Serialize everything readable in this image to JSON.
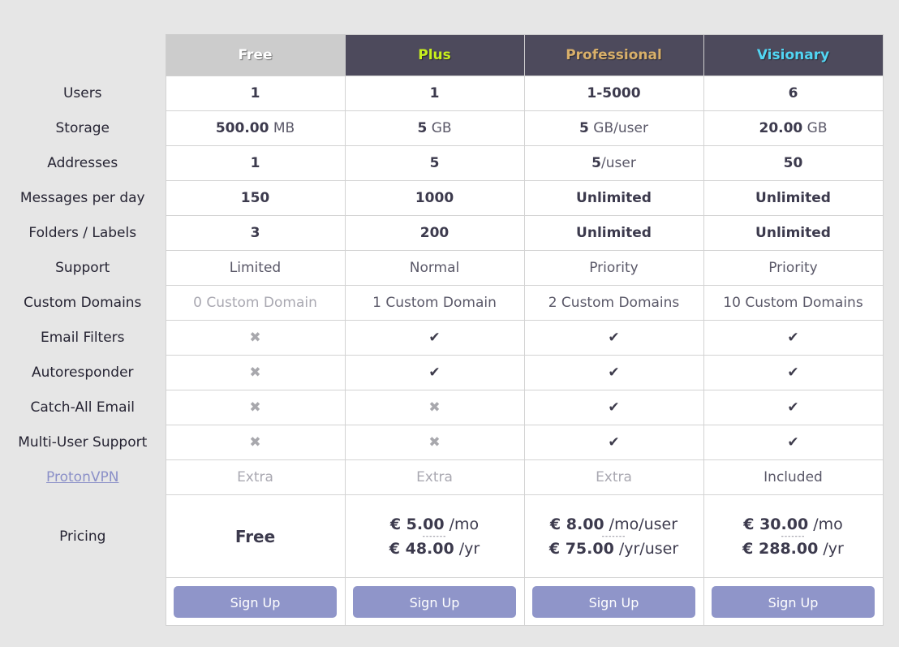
{
  "plans": [
    {
      "name": "Free",
      "color": "#ffffff"
    },
    {
      "name": "Plus",
      "color": "#c8f01e"
    },
    {
      "name": "Professional",
      "color": "#d9b06a"
    },
    {
      "name": "Visionary",
      "color": "#52d6f4"
    }
  ],
  "rows": {
    "users": {
      "label": "Users",
      "values": [
        "1",
        "1",
        "1-5000",
        "6"
      ]
    },
    "storage": {
      "label": "Storage",
      "values": [
        {
          "amount": "500.00",
          "unit": " MB"
        },
        {
          "amount": "5",
          "unit": " GB"
        },
        {
          "amount": "5",
          "unit": " GB/user"
        },
        {
          "amount": "20.00",
          "unit": " GB"
        }
      ]
    },
    "addresses": {
      "label": "Addresses",
      "values": [
        {
          "amount": "1",
          "unit": ""
        },
        {
          "amount": "5",
          "unit": ""
        },
        {
          "amount": "5",
          "unit": "/user"
        },
        {
          "amount": "50",
          "unit": ""
        }
      ]
    },
    "messages": {
      "label": "Messages per day",
      "values": [
        "150",
        "1000",
        "Unlimited",
        "Unlimited"
      ]
    },
    "folders": {
      "label": "Folders / Labels",
      "values": [
        "3",
        "200",
        "Unlimited",
        "Unlimited"
      ]
    },
    "support": {
      "label": "Support",
      "values": [
        "Limited",
        "Normal",
        "Priority",
        "Priority"
      ]
    },
    "domains": {
      "label": "Custom Domains",
      "values": [
        "0 Custom Domain",
        "1 Custom Domain",
        "2 Custom Domains",
        "10 Custom Domains"
      ]
    },
    "filters": {
      "label": "Email Filters",
      "values": [
        false,
        true,
        true,
        true
      ]
    },
    "autoresponder": {
      "label": "Autoresponder",
      "values": [
        false,
        true,
        true,
        true
      ]
    },
    "catchall": {
      "label": "Catch-All Email",
      "values": [
        false,
        false,
        true,
        true
      ]
    },
    "multiuser": {
      "label": "Multi-User Support",
      "values": [
        false,
        false,
        true,
        true
      ]
    },
    "vpn": {
      "label": "ProtonVPN",
      "values": [
        "Extra",
        "Extra",
        "Extra",
        "Included"
      ]
    },
    "pricing": {
      "label": "Pricing",
      "free_label": "Free",
      "separator": "-------",
      "values": [
        null,
        {
          "monthly": "€ 5.00",
          "monthly_unit": " /mo",
          "yearly": "€ 48.00",
          "yearly_unit": " /yr"
        },
        {
          "monthly": "€ 8.00",
          "monthly_unit": " /mo/user",
          "yearly": "€ 75.00",
          "yearly_unit": " /yr/user"
        },
        {
          "monthly": "€ 30.00",
          "monthly_unit": " /mo",
          "yearly": "€ 288.00",
          "yearly_unit": " /yr"
        }
      ]
    }
  },
  "icons": {
    "check": "✔",
    "cross": "✖"
  },
  "signup_label": "Sign Up"
}
